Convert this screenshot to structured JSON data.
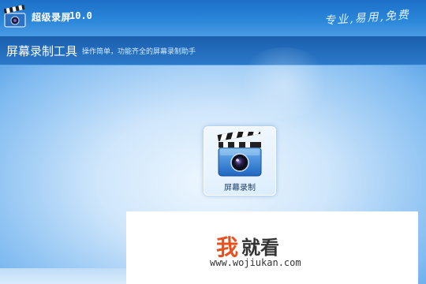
{
  "app": {
    "title": "超级录屏",
    "version": "10.0",
    "slogan": "专业,易用,免费"
  },
  "section": {
    "title": "屏幕录制工具",
    "description": "操作简单，功能齐全的屏幕录制助手"
  },
  "tiles": [
    {
      "label": "屏幕录制",
      "icon": "clapperboard-camera-icon"
    }
  ],
  "watermark": {
    "char1": "我",
    "rest": "就看",
    "url": "www.wojiukan.com"
  },
  "colors": {
    "titlebar": "#2a86d9",
    "accent": "#e8511e"
  }
}
